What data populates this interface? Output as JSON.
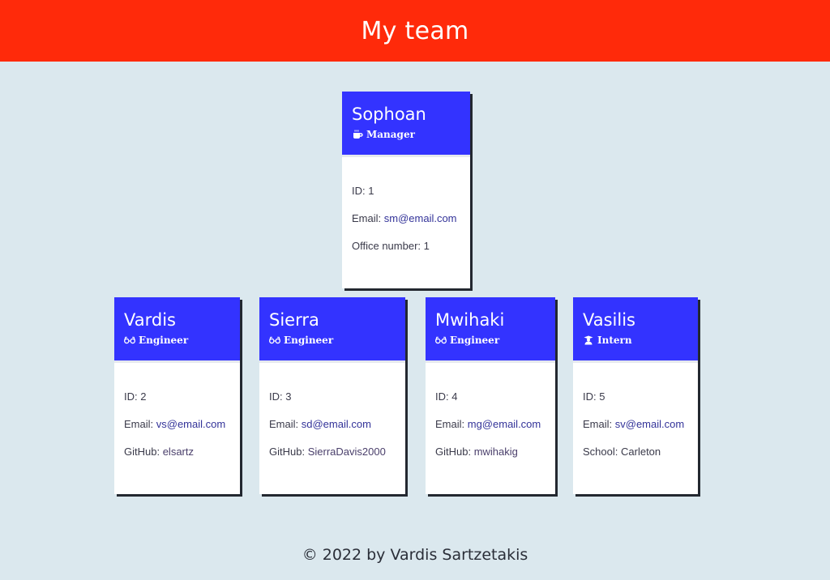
{
  "header": {
    "title": "My team"
  },
  "manager": {
    "name": "Sophoan",
    "role": "Manager",
    "role_icon": "mug-icon",
    "id_label": "ID:",
    "id": "1",
    "email_label": "Email:",
    "email": "sm@email.com",
    "extra_label": "Office number:",
    "extra": "1"
  },
  "members": [
    {
      "name": "Vardis",
      "role": "Engineer",
      "role_icon": "glasses-icon",
      "id_label": "ID:",
      "id": "2",
      "email_label": "Email:",
      "email": "vs@email.com",
      "extra_label": "GitHub:",
      "extra": "elsartz"
    },
    {
      "name": "Sierra",
      "role": "Engineer",
      "role_icon": "glasses-icon",
      "id_label": "ID:",
      "id": "3",
      "email_label": "Email:",
      "email": "sd@email.com",
      "extra_label": "GitHub:",
      "extra": "SierraDavis2000"
    },
    {
      "name": "Mwihaki",
      "role": "Engineer",
      "role_icon": "glasses-icon",
      "id_label": "ID:",
      "id": "4",
      "email_label": "Email:",
      "email": "mg@email.com",
      "extra_label": "GitHub:",
      "extra": "mwihakig"
    },
    {
      "name": "Vasilis",
      "role": "Intern",
      "role_icon": "graduate-icon",
      "id_label": "ID:",
      "id": "5",
      "email_label": "Email:",
      "email": "sv@email.com",
      "extra_label": "School:",
      "extra": "Carleton"
    }
  ],
  "footer": {
    "text": "© 2022 by Vardis Sartzetakis"
  },
  "colors": {
    "header_bg": "#ff2a0a",
    "card_head_bg": "#3333ff",
    "page_bg": "#dbe8ee",
    "link": "#333399"
  }
}
